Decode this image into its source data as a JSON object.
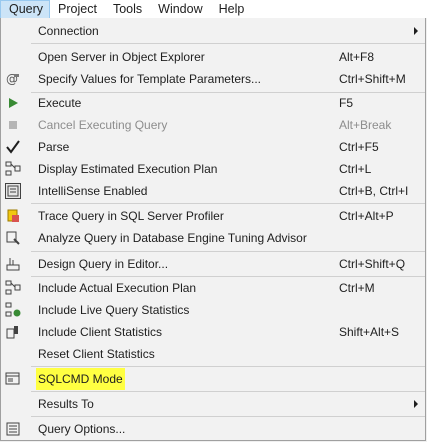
{
  "menubar": {
    "items": [
      "Query",
      "Project",
      "Tools",
      "Window",
      "Help"
    ],
    "active": "Query"
  },
  "menu": {
    "connection": {
      "label": "Connection",
      "icon": "none"
    },
    "open_server": {
      "label": "Open Server in Object Explorer",
      "shortcut": "Alt+F8"
    },
    "specify_values": {
      "label": "Specify Values for Template Parameters...",
      "shortcut": "Ctrl+Shift+M",
      "icon": "template-parameters-icon"
    },
    "execute": {
      "label": "Execute",
      "shortcut": "F5",
      "icon": "execute-play-icon",
      "color": "#388a34"
    },
    "cancel": {
      "label": "Cancel Executing Query",
      "shortcut": "Alt+Break",
      "icon": "stop-icon"
    },
    "parse": {
      "label": "Parse",
      "shortcut": "Ctrl+F5",
      "icon": "checkmark-icon"
    },
    "display_plan": {
      "label": "Display Estimated Execution Plan",
      "shortcut": "Ctrl+L",
      "icon": "execution-plan-icon"
    },
    "intellisense": {
      "label": "IntelliSense Enabled",
      "shortcut": "Ctrl+B, Ctrl+I",
      "icon": "intellisense-icon"
    },
    "trace_query": {
      "label": "Trace Query in SQL Server Profiler",
      "shortcut": "Ctrl+Alt+P",
      "icon": "profiler-icon"
    },
    "analyze_query": {
      "label": "Analyze Query in Database Engine Tuning Advisor",
      "icon": "tuning-advisor-icon"
    },
    "design_query": {
      "label": "Design Query in Editor...",
      "shortcut": "Ctrl+Shift+Q",
      "icon": "design-query-icon"
    },
    "include_actual_plan": {
      "label": "Include Actual Execution Plan",
      "shortcut": "Ctrl+M",
      "icon": "actual-plan-icon"
    },
    "include_live_stats": {
      "label": "Include Live Query Statistics",
      "icon": "live-statistics-icon"
    },
    "include_client_stats": {
      "label": "Include Client Statistics",
      "shortcut": "Shift+Alt+S",
      "icon": "client-statistics-icon"
    },
    "reset_client_stats": {
      "label": "Reset Client Statistics"
    },
    "sqlcmd_mode": {
      "label": "SQLCMD Mode",
      "icon": "sqlcmd-icon",
      "highlight_color": "#ffff42"
    },
    "results_to": {
      "label": "Results To"
    },
    "query_options": {
      "label": "Query Options...",
      "icon": "query-options-icon"
    }
  }
}
